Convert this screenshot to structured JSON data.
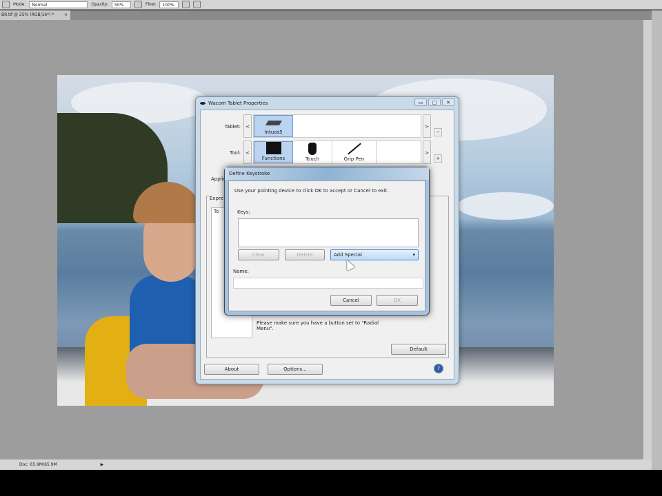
{
  "options_bar": {
    "mode_label": "Mode:",
    "mode_value": "Normal",
    "opacity_label": "Opacity:",
    "opacity_value": "50%",
    "flow_label": "Flow:",
    "flow_value": "100%"
  },
  "document_tab": {
    "title": "BR.tif @ 25% (RGB/16*) *",
    "close": "×"
  },
  "status_bar": {
    "doc_info": "Doc: 65.9M/65.9M",
    "arrow": "▶"
  },
  "wacom": {
    "title": "Wacom Tablet Properties",
    "window_buttons": [
      "▭",
      "□",
      "✕"
    ],
    "tablet_label": "Tablet:",
    "tablet_name": "Intuos5",
    "tool_label": "Tool:",
    "tools": [
      "Functions",
      "Touch",
      "Grip Pen"
    ],
    "application_label": "Applic",
    "tab_label": "Expre",
    "tree_item": "To",
    "note": "Please make sure you have a button set to \"Radial Menu\".",
    "default_button": "Default",
    "about_button": "About",
    "options_button": "Options...",
    "help_icon": "?",
    "nav_prev": "<",
    "nav_next": ">",
    "plus": "+",
    "minus": "−"
  },
  "define_keystroke": {
    "title": "Define Keystroke",
    "instruction": "Use your pointing device to click OK to accept or Cancel to exit.",
    "keys_label": "Keys:",
    "keys_value": "",
    "clear_button": "Clear",
    "delete_button": "Delete",
    "add_special": "Add Special",
    "name_label": "Name:",
    "name_value": "",
    "cancel_button": "Cancel",
    "ok_button": "OK"
  }
}
